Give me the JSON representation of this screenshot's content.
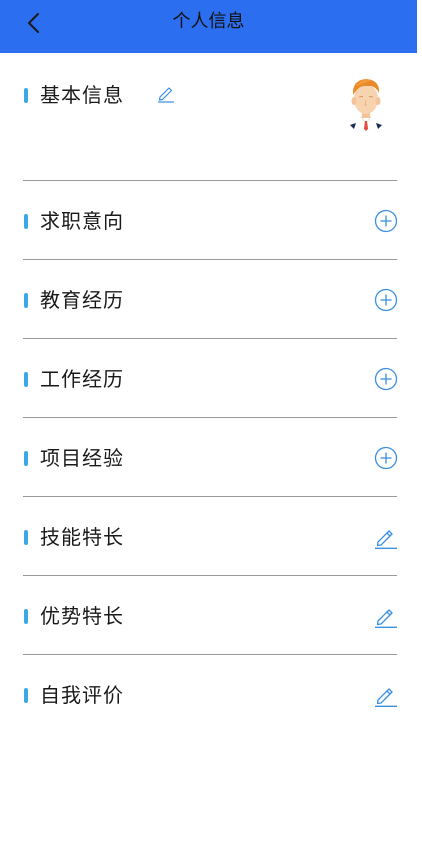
{
  "header": {
    "title": "个人信息",
    "background_color": "#2c6ef0",
    "back_icon": "chevron-left-icon"
  },
  "basic_info": {
    "label": "基本信息",
    "edit_icon": "pencil-icon",
    "avatar": "avatar-cartoon-man"
  },
  "sections": [
    {
      "label": "求职意向",
      "action_icon": "plus-circle-icon"
    },
    {
      "label": "教育经历",
      "action_icon": "plus-circle-icon"
    },
    {
      "label": "工作经历",
      "action_icon": "plus-circle-icon"
    },
    {
      "label": "项目经验",
      "action_icon": "plus-circle-icon"
    },
    {
      "label": "技能特长",
      "action_icon": "pencil-icon"
    },
    {
      "label": "优势特长",
      "action_icon": "pencil-icon"
    },
    {
      "label": "自我评价",
      "action_icon": "pencil-icon"
    }
  ],
  "colors": {
    "accent": "#2c6ef0",
    "marker": "#3aa9e6",
    "icon": "#3a8fe0",
    "divider": "#9a9a9a"
  }
}
